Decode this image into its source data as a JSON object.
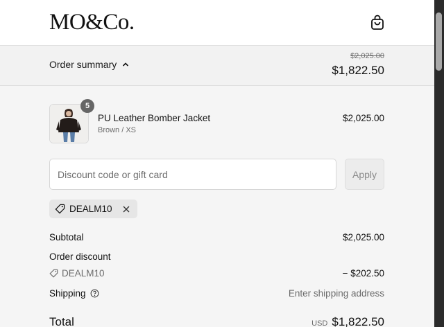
{
  "header": {
    "logo": "MO&Co.",
    "bag_icon": "shopping-bag-icon"
  },
  "summary": {
    "toggle_label": "Order summary",
    "chevron_icon": "chevron-up-icon",
    "original_price": "$2,025.00",
    "discounted_price": "$1,822.50"
  },
  "product": {
    "name": "PU Leather Bomber Jacket",
    "variant": "Brown / XS",
    "price": "$2,025.00",
    "quantity": "5"
  },
  "discount": {
    "placeholder": "Discount code or gift card",
    "value": "",
    "apply_label": "Apply",
    "applied_code": "DEALM10",
    "tag_icon": "tag-icon",
    "remove_icon": "close-icon"
  },
  "totals": {
    "subtotal_label": "Subtotal",
    "subtotal_value": "$2,025.00",
    "order_discount_label": "Order discount",
    "order_discount_code": "DEALM10",
    "order_discount_value": "− $202.50",
    "shipping_label": "Shipping",
    "shipping_help_icon": "help-circle-icon",
    "shipping_value": "Enter shipping address",
    "total_label": "Total",
    "total_currency": "USD",
    "total_value": "$1,822.50"
  }
}
